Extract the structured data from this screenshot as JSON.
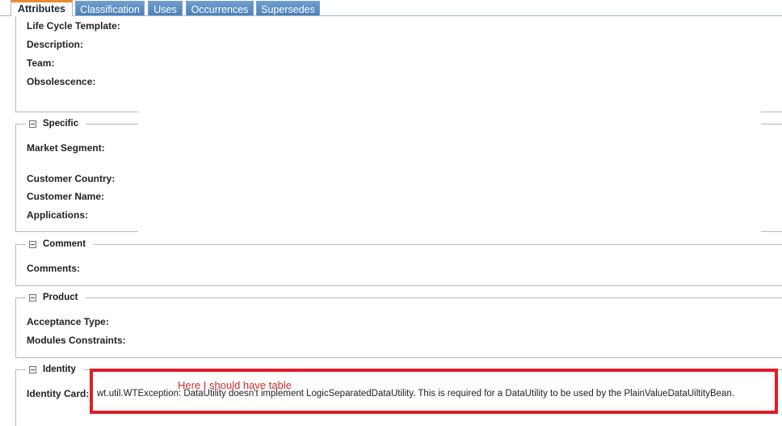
{
  "tabs": [
    {
      "label": "Attributes",
      "active": true
    },
    {
      "label": "Classification",
      "active": false
    },
    {
      "label": "Uses",
      "active": false
    },
    {
      "label": "Occurrences",
      "active": false
    },
    {
      "label": "Supersedes",
      "active": false
    }
  ],
  "general": {
    "labels": {
      "life_cycle_template": "Life Cycle Template:",
      "description": "Description:",
      "team": "Team:",
      "obsolescence": "Obsolescence:"
    }
  },
  "specific": {
    "title": "Specific",
    "labels": {
      "market_segment": "Market Segment:",
      "customer_country": "Customer Country:",
      "customer_name": "Customer Name:",
      "applications": "Applications:"
    }
  },
  "comment": {
    "title": "Comment",
    "labels": {
      "comments": "Comments:"
    }
  },
  "product": {
    "title": "Product",
    "labels": {
      "acceptance_type": "Acceptance Type:",
      "modules_constraints": "Modules Constraints:"
    }
  },
  "identity": {
    "title": "Identity",
    "labels": {
      "identity_card": "Identity Card:"
    },
    "error": "wt.util.WTException: DataUtility doesn't implement LogicSeparatedDataUtility. This is required for a DataUtility to be used by the PlainValueDataUiltityBean."
  },
  "annotation": {
    "text": "Here I should have table",
    "color": "#e01c28"
  },
  "colors": {
    "active_tab_accent": "#e88a2e",
    "inactive_tab": "#4a7fb8"
  }
}
